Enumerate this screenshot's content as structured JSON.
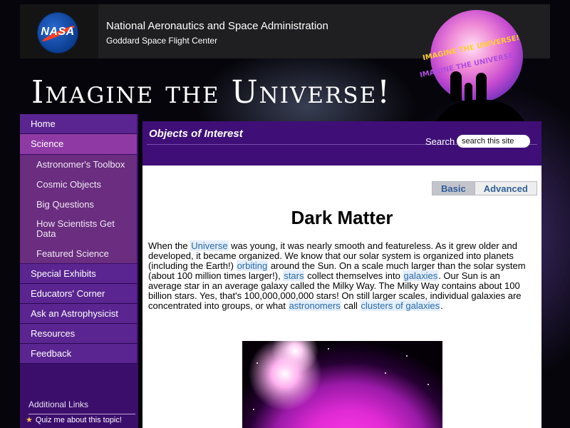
{
  "header": {
    "logo_text": "NASA",
    "agency": "National Aeronautics and Space Administration",
    "center": "Goddard Space Flight Center"
  },
  "site": {
    "title": "Imagine the Universe!",
    "logo_line1": "IMAGINE THE UNIVERSE!",
    "logo_line2": "IMAGINE THE UNIVERSE!"
  },
  "sidebar": {
    "items": [
      {
        "label": "Home"
      },
      {
        "label": "Science"
      },
      {
        "label": "Astronomer's Toolbox"
      },
      {
        "label": "Cosmic Objects"
      },
      {
        "label": "Big Questions"
      },
      {
        "label": "How Scientists Get Data"
      },
      {
        "label": "Featured Science"
      },
      {
        "label": "Special Exhibits"
      },
      {
        "label": "Educators' Corner"
      },
      {
        "label": "Ask an Astrophysicist"
      },
      {
        "label": "Resources"
      },
      {
        "label": "Feedback"
      }
    ],
    "additional_links": "Additional Links",
    "quiz": "Quiz me about this topic!"
  },
  "main": {
    "section_title": "Objects of Interest",
    "search_label": "Search",
    "search_placeholder": "search this site",
    "tabs": {
      "basic": "Basic",
      "advanced": "Advanced"
    },
    "page_title": "Dark Matter",
    "intro": {
      "t1": "When the ",
      "l1": "Universe",
      "t2": " was young, it was nearly smooth and featureless. As it grew older and developed, it became organized. We know that our solar system is organized into planets (including the Earth!) ",
      "l2": "orbiting",
      "t3": " around the Sun. On a scale much larger than the solar system (about 100 million times larger!), ",
      "l3": "stars",
      "t4": " collect themselves into ",
      "l4": "galaxies",
      "t5": ". Our Sun is an average star in an average galaxy called the Milky Way. The Milky Way contains about 100 billion stars. Yes, that's 100,000,000,000 stars! On still larger scales, individual galaxies are concentrated into groups, or what ",
      "l5": "astronomers",
      "t6": " call ",
      "l6": "clusters of galaxies",
      "t7": "."
    }
  },
  "colors": {
    "sidebar_bg": "#3b0e6c",
    "nav_active": "#8f3aa4",
    "header_bg": "#1f1f21",
    "link": "#2a6aa8"
  }
}
